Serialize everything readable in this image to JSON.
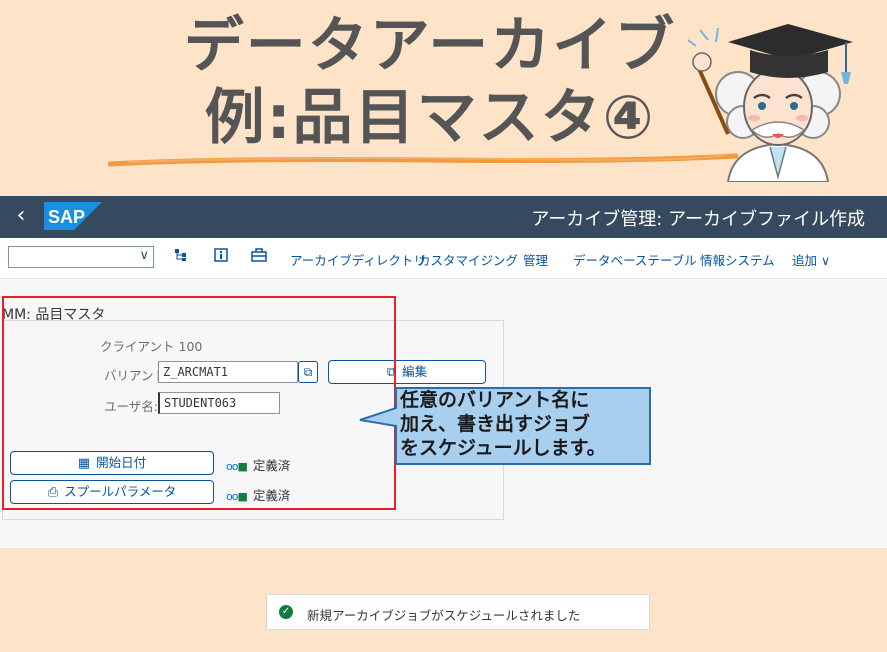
{
  "title": {
    "line1": "データアーカイブ",
    "line2": "例:品目マスタ④"
  },
  "colors": {
    "shell": "#354a5f",
    "highlight": "#e8202a",
    "callout_fill": "#a9cfef",
    "background": "#fde4c9",
    "accent": "#0854a0"
  },
  "shell": {
    "back_icon": "chevron-left-icon",
    "logo": "SAP",
    "title": "アーカイブ管理: アーカイブファイル作成"
  },
  "toolbar": {
    "combo_value": "",
    "icons": [
      "hierarchy-icon",
      "info-icon",
      "briefcase-icon"
    ],
    "items": [
      "アーカイブディレクトリ",
      "カスタマイジング",
      "管理",
      "データベーステーブル",
      "情報システム",
      "追加"
    ]
  },
  "form": {
    "section_label": "MM: 品目マスタ",
    "client_label": "クライアント",
    "client_value": "100",
    "variant_label": "バリアント:",
    "variant_value": "Z_ARCMAT1",
    "edit_button": "編集",
    "user_label": "ユーザ名:",
    "user_value": "STUDENT063",
    "start_date_button": "開始日付",
    "spool_button": "スプールパラメータ",
    "status_start": "定義済",
    "status_spool": "定義済"
  },
  "callout": {
    "lines": [
      "任意のバリアント名に",
      "加え、書き出すジョブ",
      "をスケジュールします。"
    ]
  },
  "toast": {
    "message": "新規アーカイブジョブがスケジュールされました"
  }
}
